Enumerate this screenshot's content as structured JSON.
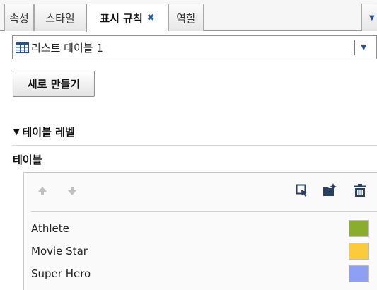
{
  "tabs": [
    {
      "label": "속성"
    },
    {
      "label": "스타일"
    },
    {
      "label": "표시 규칙",
      "close": "✖"
    },
    {
      "label": "역할"
    }
  ],
  "table_selector": {
    "value": "리스트 테이블 1",
    "icon": "table-icon",
    "arrow": "▼"
  },
  "new_button": {
    "label": "새로 만들기"
  },
  "section": {
    "toggle": "▼",
    "title": "테이블 레벨"
  },
  "group": {
    "label": "테이블"
  },
  "toolbar_icons": [
    "move-up-icon",
    "move-down-icon",
    "edit-icon",
    "new-rule-icon",
    "delete-icon"
  ],
  "rules": [
    {
      "label": "Athlete",
      "color": "#8aad2b"
    },
    {
      "label": "Movie Star",
      "color": "#fbcb3a"
    },
    {
      "label": "Super Hero",
      "color": "#8da0f4"
    }
  ],
  "colors": {
    "accent": "#2a4f8a",
    "icon_dark": "#2b3f5f",
    "icon_disabled": "#c0c0c0"
  }
}
